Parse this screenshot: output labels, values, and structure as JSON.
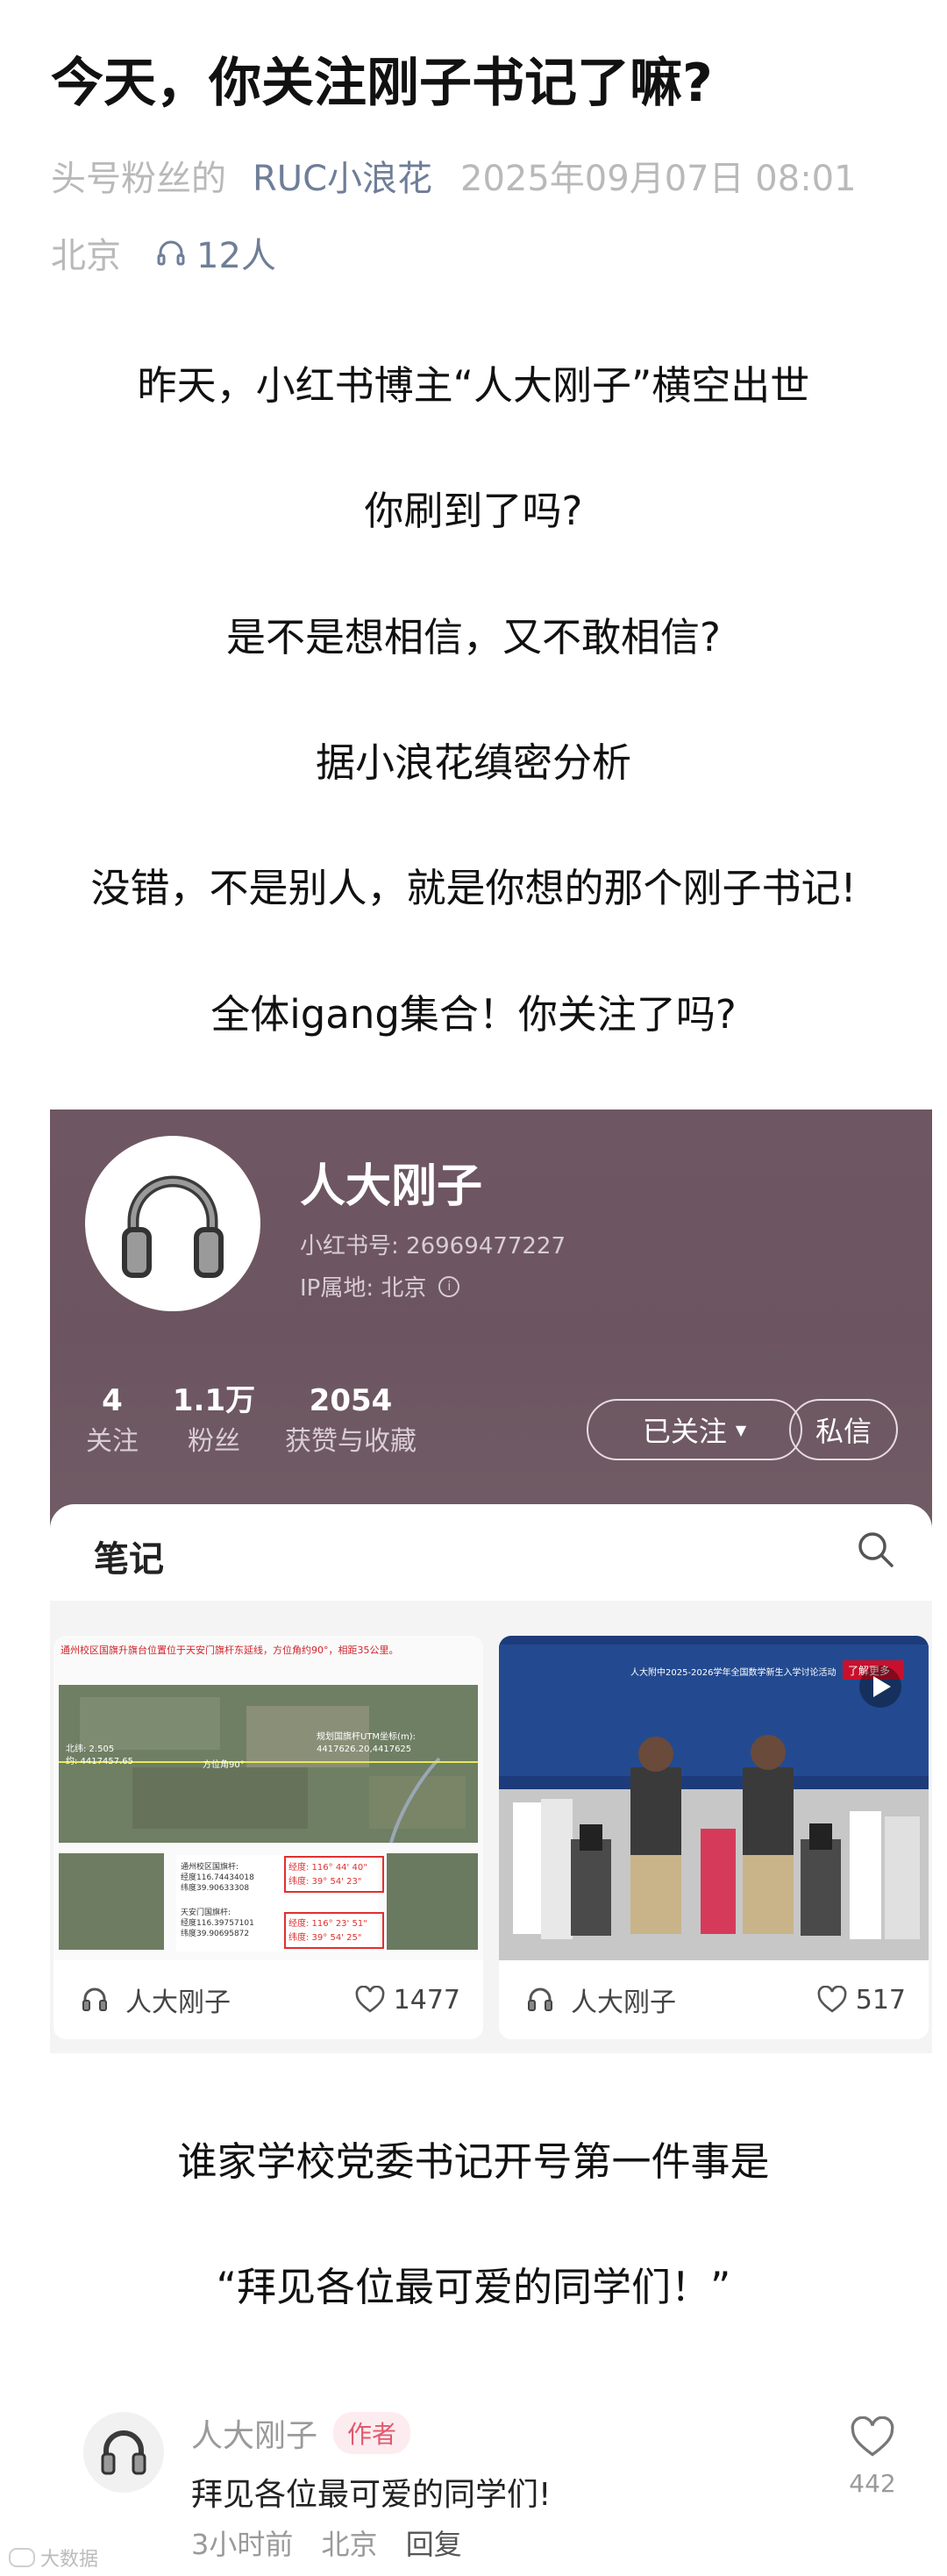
{
  "article": {
    "title": "今天，你关注刚子书记了嘛?",
    "source": "头号粉丝的",
    "author": "RUC小浪花",
    "datetime": "2025年09月07日 08:01",
    "location": "北京",
    "listeners": "12人"
  },
  "paragraphs": [
    "昨天，小红书博主“人大刚子”横空出世",
    "你刷到了吗?",
    "是不是想相信，又不敢相信?",
    "据小浪花缜密分析",
    "没错，不是别人，就是你想的那个刚子书记!",
    "全体igang集合！你关注了吗?"
  ],
  "profile": {
    "name": "人大刚子",
    "id_label": "小红书号: 26969477227",
    "ip_label": "IP属地: 北京",
    "info_icon": "info-icon",
    "stats": [
      {
        "num": "4",
        "label": "关注"
      },
      {
        "num": "1.1万",
        "label": "粉丝"
      },
      {
        "num": "2054",
        "label": "获赞与收藏"
      }
    ],
    "follow_button": "已关注",
    "message_button": "私信",
    "header_color": "#6e5762"
  },
  "notes": {
    "title": "笔记",
    "cards": [
      {
        "author": "人大刚子",
        "likes": "1477",
        "image": {
          "headline": "通州校区国旗升旗台位置位于天安门旗杆东延线，方位角约90°，相距35公里。",
          "labels": [
            "北纬: 2.505",
            "约: 4417457.65",
            "规划国旗杆UTM坐标(m):",
            "4417626.20,4417625",
            "方位角90°"
          ],
          "box1": [
            "通州校区国旗杆:",
            "经度116.74434018",
            "纬度39.90633308"
          ],
          "box2": [
            "天安门国旗杆:",
            "经度116.39757101",
            "纬度39.90695872"
          ],
          "coord1": [
            "经度: 116° 44' 40\"",
            "纬度: 39° 54' 23\""
          ],
          "coord2": [
            "经度: 116° 23' 51\"",
            "纬度: 39° 54' 25\""
          ]
        }
      },
      {
        "author": "人大刚子",
        "likes": "517",
        "image": {
          "stamp": "了解更多",
          "board": "人大附中2025-2026学年全国数学新生入学讨论活动"
        }
      }
    ]
  },
  "paragraphs2": [
    "谁家学校党委书记开号第一件事是",
    "“拜见各位最可爱的同学们！”"
  ],
  "comment": {
    "name": "人大刚子",
    "tag": "作者",
    "text": "拜见各位最可爱的同学们!",
    "time": "3小时前",
    "location": "北京",
    "reply": "回复",
    "likes": "442"
  },
  "watermark": "大数据"
}
